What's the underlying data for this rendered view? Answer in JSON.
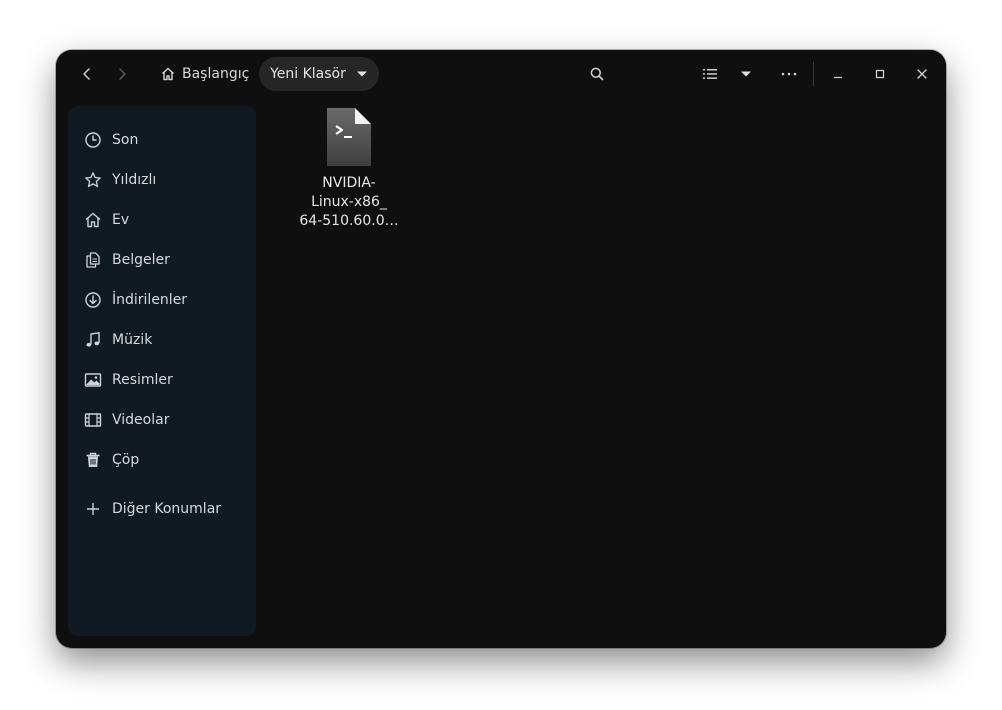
{
  "header": {
    "back_icon": "chevron-left-icon",
    "forward_icon": "chevron-right-icon",
    "home_crumb_label": "Başlangıç",
    "current_crumb_label": "Yeni Klasör",
    "search_icon": "search-icon",
    "view_icon": "list-view-icon",
    "menu_icon": "more-icon"
  },
  "sidebar": {
    "items": [
      {
        "label": "Son",
        "icon": "clock-icon"
      },
      {
        "label": "Yıldızlı",
        "icon": "star-icon"
      },
      {
        "label": "Ev",
        "icon": "home-icon"
      },
      {
        "label": "Belgeler",
        "icon": "documents-icon"
      },
      {
        "label": "İndirilenler",
        "icon": "download-icon"
      },
      {
        "label": "Müzik",
        "icon": "music-icon"
      },
      {
        "label": "Resimler",
        "icon": "picture-icon"
      },
      {
        "label": "Videolar",
        "icon": "video-icon"
      },
      {
        "label": "Çöp",
        "icon": "trash-icon"
      }
    ],
    "other_locations_label": "Diğer Konumlar"
  },
  "files": [
    {
      "name_lines": [
        "NVIDIA-",
        "Linux-x86_",
        "64-510.60.0…"
      ],
      "icon": "script-file-icon"
    }
  ],
  "colors": {
    "window_bg": "#0f0f10",
    "sidebar_bg": "#111922",
    "crumb_active_bg": "#262626",
    "text": "#d6d9dd"
  }
}
